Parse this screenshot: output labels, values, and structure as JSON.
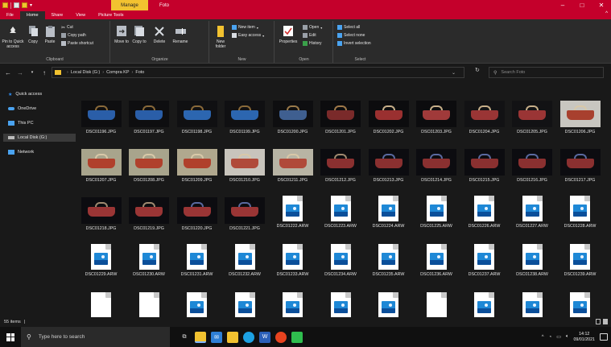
{
  "titlebar": {
    "manage_tab": "Manage",
    "window_title": "Foto",
    "controls": {
      "minimize": "–",
      "maximize": "□",
      "close": "✕"
    }
  },
  "ribbon_tabs": {
    "items": [
      "File",
      "Home",
      "Share",
      "View",
      "Picture Tools"
    ],
    "collapse": "^"
  },
  "ribbon": {
    "clipboard": {
      "pin": "Pin to Quick access",
      "copy": "Copy",
      "paste": "Paste",
      "cut": "Cut",
      "copy_path": "Copy path",
      "paste_shortcut": "Paste shortcut",
      "label": "Clipboard"
    },
    "organize": {
      "move": "Move to",
      "copy": "Copy to",
      "delete": "Delete",
      "rename": "Rename",
      "label": "Organize"
    },
    "new": {
      "new_folder": "New folder",
      "new_item": "New item",
      "easy_access": "Easy access",
      "label": "New"
    },
    "open": {
      "properties": "Properties",
      "open": "Open",
      "edit": "Edit",
      "history": "History",
      "label": "Open"
    },
    "select": {
      "select_all": "Select all",
      "select_none": "Select none",
      "invert": "Invert selection",
      "label": "Select"
    }
  },
  "address": {
    "path": [
      "Local Disk (G:)",
      "Compra KP",
      "Foto"
    ],
    "search_placeholder": "Search Foto"
  },
  "sidebar": {
    "items": [
      {
        "label": "Quick access",
        "icon": "star-icon",
        "color": "#2d8cf0"
      },
      {
        "label": "OneDrive",
        "icon": "cloud-icon",
        "color": "#4aa3f0"
      },
      {
        "label": "This PC",
        "icon": "monitor-icon",
        "color": "#4aa3f0"
      },
      {
        "label": "Local Disk (G:)",
        "icon": "drive-icon",
        "color": "#bbbbbb"
      },
      {
        "label": "Network",
        "icon": "network-icon",
        "color": "#4aa3f0"
      }
    ]
  },
  "files": [
    {
      "name": "DSC01196.JPG",
      "kind": "photo",
      "bg": "#0e0e10",
      "bag": "#2a5ea8",
      "strap": "#8a6a3a"
    },
    {
      "name": "DSC01197.JPG",
      "kind": "photo",
      "bg": "#0e0e10",
      "bag": "#2a5ea8",
      "strap": "#8a6a3a"
    },
    {
      "name": "DSC01198.JPG",
      "kind": "photo",
      "bg": "#101012",
      "bag": "#2c66b0",
      "strap": "#8a6a3a"
    },
    {
      "name": "DSC01199.JPG",
      "kind": "photo",
      "bg": "#101012",
      "bag": "#2c66b0",
      "strap": "#8a6a3a"
    },
    {
      "name": "DSC01200.JPG",
      "kind": "photo",
      "bg": "#0e0e10",
      "bag": "#3f5f90",
      "strap": "#9a7a4a"
    },
    {
      "name": "DSC01201.JPG",
      "kind": "photo",
      "bg": "#0c0c0e",
      "bag": "#7a2a2a",
      "strap": "#a07a4a"
    },
    {
      "name": "DSC01202.JPG",
      "kind": "photo",
      "bg": "#0c0c0e",
      "bag": "#9a3030",
      "strap": "#c8b08a"
    },
    {
      "name": "DSC01203.JPG",
      "kind": "photo",
      "bg": "#0c0c0e",
      "bag": "#a03a3a",
      "strap": "#c8b08a"
    },
    {
      "name": "DSC01204.JPG",
      "kind": "photo",
      "bg": "#121214",
      "bag": "#9a3535",
      "strap": "#c8b08a"
    },
    {
      "name": "DSC01205.JPG",
      "kind": "photo",
      "bg": "#121214",
      "bag": "#9a3535",
      "strap": "#c8b08a"
    },
    {
      "name": "DSC01206.JPG",
      "kind": "photo",
      "bg": "#c8c6c0",
      "bag": "#a8402e",
      "strap": "#d8c8a8"
    },
    {
      "name": "DSC01207.JPG",
      "kind": "photo",
      "bg": "#a8a48c",
      "bag": "#b0402c",
      "strap": "#d8c8a8"
    },
    {
      "name": "DSC01208.JPG",
      "kind": "photo",
      "bg": "#a8a48c",
      "bag": "#b0402c",
      "strap": "#d8c8a8"
    },
    {
      "name": "DSC01209.JPG",
      "kind": "photo",
      "bg": "#b0a88e",
      "bag": "#b0402c",
      "strap": "#d8c8a8"
    },
    {
      "name": "DSC01210.JPG",
      "kind": "photo",
      "bg": "#c8c4bc",
      "bag": "#b04a3a",
      "strap": "#d8c8a8"
    },
    {
      "name": "DSC01211.JPG",
      "kind": "photo",
      "bg": "#b8b4a4",
      "bag": "#b04a3a",
      "strap": "#d8c8a8"
    },
    {
      "name": "DSC01212.JPG",
      "kind": "photo",
      "bg": "#0c0c10",
      "bag": "#8a3030",
      "strap": "#a08a70"
    },
    {
      "name": "DSC01213.JPG",
      "kind": "photo",
      "bg": "#0c0c10",
      "bag": "#8a3030",
      "strap": "#5a6aa0"
    },
    {
      "name": "DSC01214.JPG",
      "kind": "photo",
      "bg": "#0c0c10",
      "bag": "#8a3030",
      "strap": "#5a6aa0"
    },
    {
      "name": "DSC01215.JPG",
      "kind": "photo",
      "bg": "#0c0c10",
      "bag": "#8a3030",
      "strap": "#5a6aa0"
    },
    {
      "name": "DSC01216.JPG",
      "kind": "photo",
      "bg": "#0c0c10",
      "bag": "#8a3030",
      "strap": "#5a6aa0"
    },
    {
      "name": "DSC01217.JPG",
      "kind": "photo",
      "bg": "#0c0c10",
      "bag": "#8a3030",
      "strap": "#5a6aa0"
    },
    {
      "name": "DSC01218.JPG",
      "kind": "photo",
      "bg": "#0c0c10",
      "bag": "#9a3535",
      "strap": "#a08a70"
    },
    {
      "name": "DSC01219.JPG",
      "kind": "photo",
      "bg": "#0c0c10",
      "bag": "#9a3535",
      "strap": "#a08a70"
    },
    {
      "name": "DSC01220.JPG",
      "kind": "photo",
      "bg": "#0c0c10",
      "bag": "#9a3535",
      "strap": "#5a6aa0"
    },
    {
      "name": "DSC01221.JPG",
      "kind": "photo",
      "bg": "#0c0c10",
      "bag": "#9a3535",
      "strap": "#5a6aa0"
    },
    {
      "name": "DSC01222.ARW",
      "kind": "raw"
    },
    {
      "name": "DSC01223.ARW",
      "kind": "raw"
    },
    {
      "name": "DSC01224.ARW",
      "kind": "raw"
    },
    {
      "name": "DSC01225.ARW",
      "kind": "raw"
    },
    {
      "name": "DSC01226.ARW",
      "kind": "raw"
    },
    {
      "name": "DSC01227.ARW",
      "kind": "raw"
    },
    {
      "name": "DSC01228.ARW",
      "kind": "raw"
    },
    {
      "name": "DSC01229.ARW",
      "kind": "raw"
    },
    {
      "name": "DSC01230.ARW",
      "kind": "raw"
    },
    {
      "name": "DSC01231.ARW",
      "kind": "raw"
    },
    {
      "name": "DSC01232.ARW",
      "kind": "raw"
    },
    {
      "name": "DSC01233.ARW",
      "kind": "raw"
    },
    {
      "name": "DSC01234.ARW",
      "kind": "raw"
    },
    {
      "name": "DSC01235.ARW",
      "kind": "raw"
    },
    {
      "name": "DSC01236.ARW",
      "kind": "raw"
    },
    {
      "name": "DSC01237.ARW",
      "kind": "raw"
    },
    {
      "name": "DSC01238.ARW",
      "kind": "raw"
    },
    {
      "name": "DSC01239.ARW",
      "kind": "raw"
    },
    {
      "name": "",
      "kind": "blank"
    },
    {
      "name": "",
      "kind": "blank"
    },
    {
      "name": "",
      "kind": "raw"
    },
    {
      "name": "",
      "kind": "raw"
    },
    {
      "name": "",
      "kind": "raw"
    },
    {
      "name": "",
      "kind": "raw"
    },
    {
      "name": "",
      "kind": "raw"
    },
    {
      "name": "",
      "kind": "blank"
    },
    {
      "name": "",
      "kind": "raw"
    },
    {
      "name": "",
      "kind": "raw"
    },
    {
      "name": "",
      "kind": "raw"
    }
  ],
  "status": {
    "count": "55 items",
    "separator": "|"
  },
  "taskbar": {
    "search_placeholder": "Type here to search",
    "time": "14:12",
    "date": "09/01/2021"
  },
  "colors": {
    "title_red": "#c4002b",
    "manage_yellow": "#f2c230",
    "raw_blue": "#1e88d6"
  }
}
